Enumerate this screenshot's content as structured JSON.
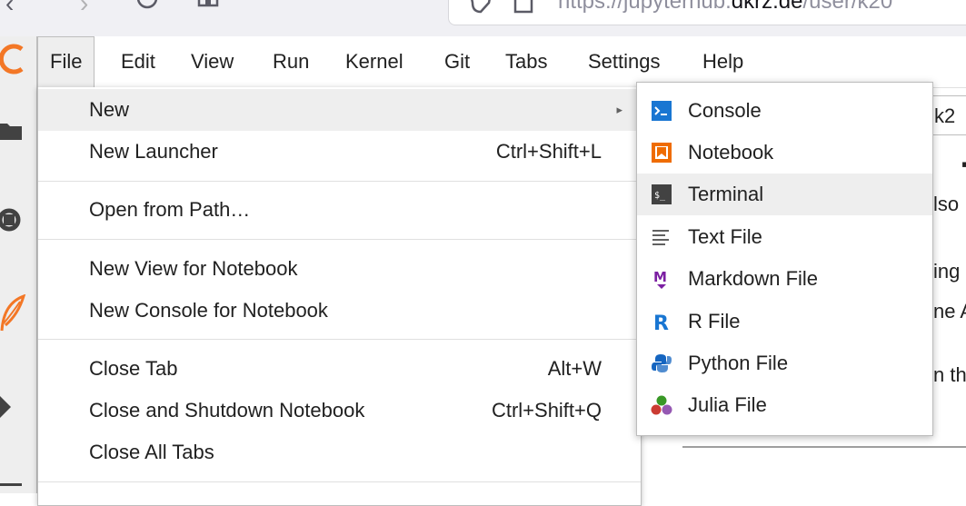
{
  "browser": {
    "url_prefix": "https://jupyterhub.",
    "url_domain": "dkrz.de",
    "url_suffix": "/user/k20"
  },
  "menubar": {
    "items": [
      "File",
      "Edit",
      "View",
      "Run",
      "Kernel",
      "Git",
      "Tabs",
      "Settings",
      "Help"
    ]
  },
  "file_menu": {
    "new": "New",
    "new_launcher": "New Launcher",
    "new_launcher_shortcut": "Ctrl+Shift+L",
    "open_from_path": "Open from Path…",
    "new_view": "New View for Notebook",
    "new_console": "New Console for Notebook",
    "close_tab": "Close Tab",
    "close_tab_shortcut": "Alt+W",
    "close_shutdown": "Close and Shutdown Notebook",
    "close_shutdown_shortcut": "Ctrl+Shift+Q",
    "close_all": "Close All Tabs"
  },
  "new_submenu": {
    "items": [
      {
        "label": "Console",
        "icon": "console-icon"
      },
      {
        "label": "Notebook",
        "icon": "notebook-icon"
      },
      {
        "label": "Terminal",
        "icon": "terminal-icon"
      },
      {
        "label": "Text File",
        "icon": "text-file-icon"
      },
      {
        "label": "Markdown File",
        "icon": "markdown-icon"
      },
      {
        "label": "R File",
        "icon": "r-file-icon"
      },
      {
        "label": "Python File",
        "icon": "python-icon"
      },
      {
        "label": "Julia File",
        "icon": "julia-icon"
      }
    ]
  },
  "background_doc": {
    "tab_label": "k2",
    "fragments": [
      "lso",
      "ing",
      "ne A",
      "n th"
    ]
  },
  "colors": {
    "console_icon": "#1976d2",
    "notebook_icon": "#ef6c00",
    "terminal_icon": "#424242",
    "markdown_icon": "#7b1fa2",
    "r_icon": "#1976d2",
    "jupyter_orange": "#f37726",
    "hover": "#eeeeee"
  }
}
